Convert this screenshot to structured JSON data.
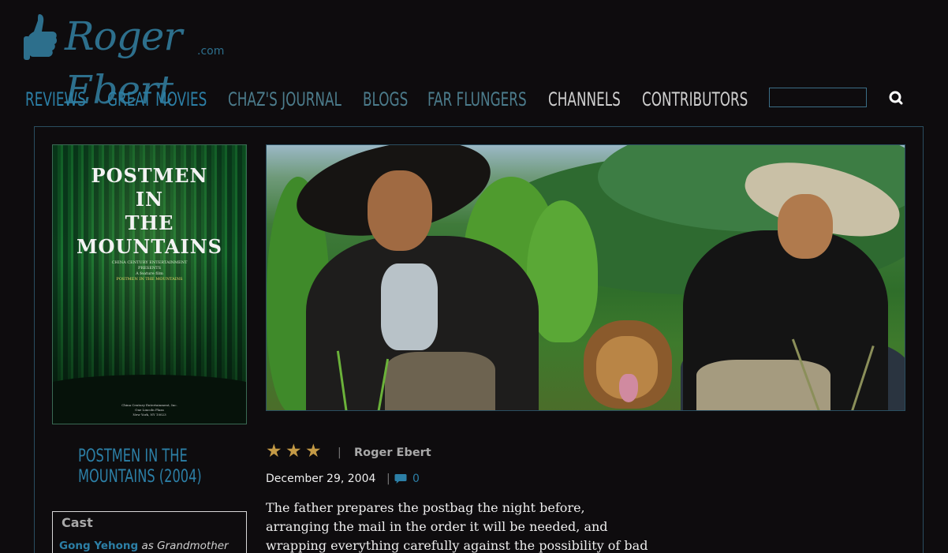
{
  "logo": {
    "script_text": "Roger Ebert",
    "domain_suffix": ".com"
  },
  "nav": {
    "items": [
      {
        "label": "REVIEWS"
      },
      {
        "label": "GREAT MOVIES"
      },
      {
        "label": "CHAZ'S JOURNAL"
      },
      {
        "label": "BLOGS"
      },
      {
        "label": "FAR FLUNGERS"
      },
      {
        "label": "CHANNELS"
      },
      {
        "label": "CONTRIBUTORS"
      }
    ],
    "search": {
      "placeholder": ""
    }
  },
  "poster": {
    "title_lines": [
      "POSTMEN",
      "IN",
      "THE",
      "MOUNTAINS"
    ],
    "presenter": "CHINA CENTURY ENTERTAINMENT PRESENTS",
    "tagline": "A feature film",
    "film_name": "POSTMEN IN THE MOUNTAINS",
    "distributor": "China Century Entertainment, Inc.",
    "address_1": "One Lincoln Plaza",
    "address_2": "New York, NY 10023"
  },
  "movie": {
    "title": "POSTMEN IN THE MOUNTAINS (2004)",
    "rating_stars": 3
  },
  "cast": {
    "heading": "Cast",
    "members": [
      {
        "actor": "Gong Yehong",
        "role": "as Grandmother"
      }
    ]
  },
  "review": {
    "author": "Roger Ebert",
    "date": "December 29, 2004",
    "comment_count": "0",
    "body": "The father prepares the postbag the night before, arranging the mail in the order it will be needed, and wrapping everything carefully against the possibility of bad weather. This will be the last time he"
  },
  "colors": {
    "background": "#0e0c0e",
    "link_blue": "#2c7fa6",
    "star_gold": "#c49a46",
    "frame_border": "#2a4e60"
  }
}
